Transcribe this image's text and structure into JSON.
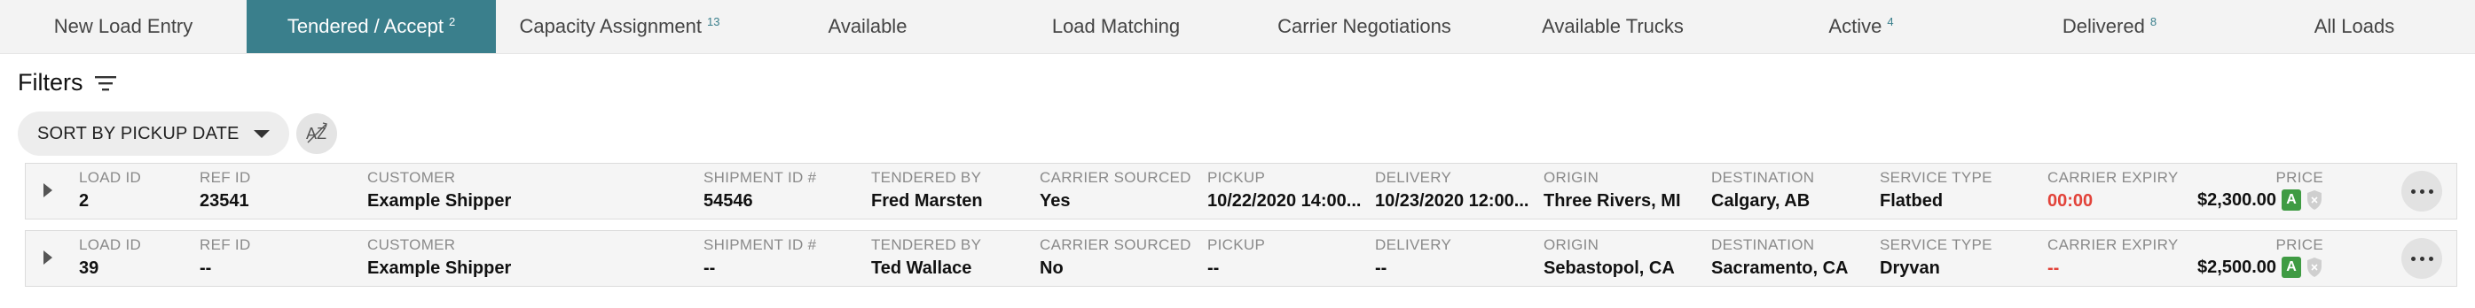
{
  "tabs": [
    {
      "label": "New Load Entry",
      "badge": ""
    },
    {
      "label": "Tendered / Accept",
      "badge": "2"
    },
    {
      "label": "Capacity Assignment",
      "badge": "13"
    },
    {
      "label": "Available",
      "badge": ""
    },
    {
      "label": "Load Matching",
      "badge": ""
    },
    {
      "label": "Carrier Negotiations",
      "badge": ""
    },
    {
      "label": "Available Trucks",
      "badge": ""
    },
    {
      "label": "Active",
      "badge": "4"
    },
    {
      "label": "Delivered",
      "badge": "8"
    },
    {
      "label": "All Loads",
      "badge": ""
    }
  ],
  "active_tab": "Tendered / Accept",
  "filters": {
    "title": "Filters",
    "icon": "filter-lines-icon"
  },
  "sort": {
    "label": "SORT BY PICKUP DATE",
    "az_icon": "sort-az-icon"
  },
  "columns": {
    "load_id": "LOAD ID",
    "ref_id": "REF ID",
    "customer": "CUSTOMER",
    "shipment_id": "SHIPMENT ID #",
    "tendered_by": "TENDERED BY",
    "carrier_sourced": "CARRIER SOURCED",
    "pickup": "PICKUP",
    "delivery": "DELIVERY",
    "origin": "ORIGIN",
    "destination": "DESTINATION",
    "service_type": "SERVICE TYPE",
    "carrier_expiry": "CARRIER EXPIRY",
    "price": "PRICE"
  },
  "loads": [
    {
      "load_id": "2",
      "ref_id": "23541",
      "customer": "Example Shipper",
      "shipment_id": "54546",
      "tendered_by": "Fred Marsten",
      "carrier_sourced": "Yes",
      "pickup": "10/22/2020 14:00...",
      "delivery": "10/23/2020 12:00...",
      "origin": "Three Rivers, MI",
      "destination": "Calgary, AB",
      "service_type": "Flatbed",
      "carrier_expiry": "00:00",
      "price": "$2,300.00",
      "badge": "A"
    },
    {
      "load_id": "39",
      "ref_id": "--",
      "customer": "Example Shipper",
      "shipment_id": "--",
      "tendered_by": "Ted Wallace",
      "carrier_sourced": "No",
      "pickup": "--",
      "delivery": "--",
      "origin": "Sebastopol, CA",
      "destination": "Sacramento, CA",
      "service_type": "Dryvan",
      "carrier_expiry": "--",
      "price": "$2,500.00",
      "badge": "A"
    }
  ],
  "colors": {
    "active_tab": "#3a7f8c",
    "expiry_red": "#e2433a",
    "badge_green": "#3f9b43"
  }
}
